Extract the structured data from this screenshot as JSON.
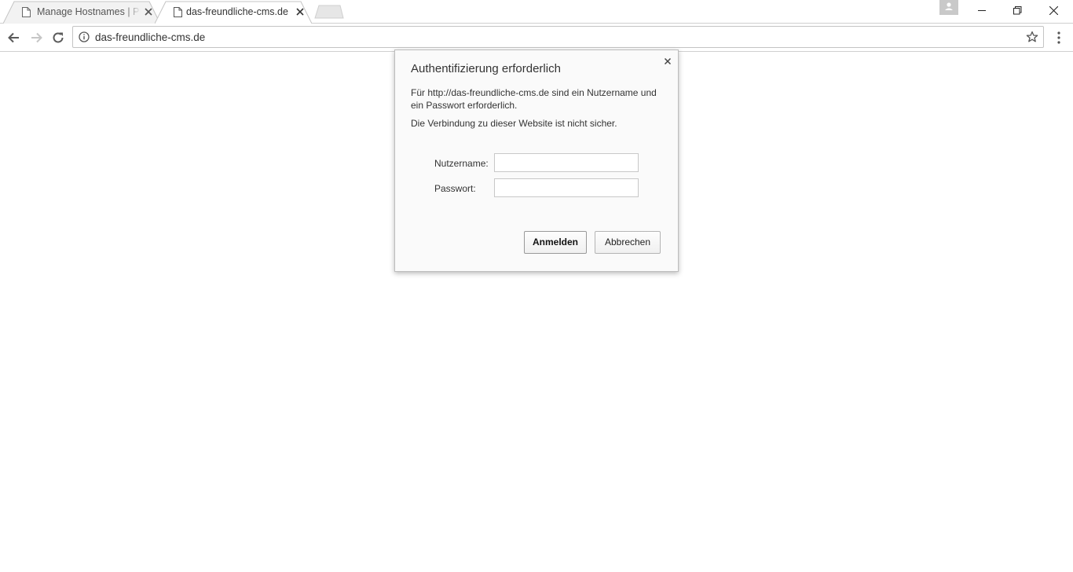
{
  "tabs": [
    {
      "title": "Manage Hostnames | Pro",
      "active": false,
      "icon": "page-icon"
    },
    {
      "title": "das-freundliche-cms.de",
      "active": true,
      "icon": "page-icon"
    }
  ],
  "toolbar": {
    "url": "das-freundliche-cms.de",
    "icons": [
      "back-icon",
      "forward-icon",
      "reload-icon",
      "info-icon",
      "star-icon",
      "menu-icon"
    ]
  },
  "window_controls": [
    "minimize-icon",
    "restore-icon",
    "close-icon"
  ],
  "dialog": {
    "title": "Authentifizierung erforderlich",
    "message": "Für http://das-freundliche-cms.de sind ein Nutzername und ein Passwort erforderlich.",
    "warning": "Die Verbindung zu dieser Website ist nicht sicher.",
    "username_label": "Nutzername:",
    "username_value": "",
    "password_label": "Passwort:",
    "password_value": "",
    "ok_label": "Anmelden",
    "cancel_label": "Abbrechen"
  }
}
